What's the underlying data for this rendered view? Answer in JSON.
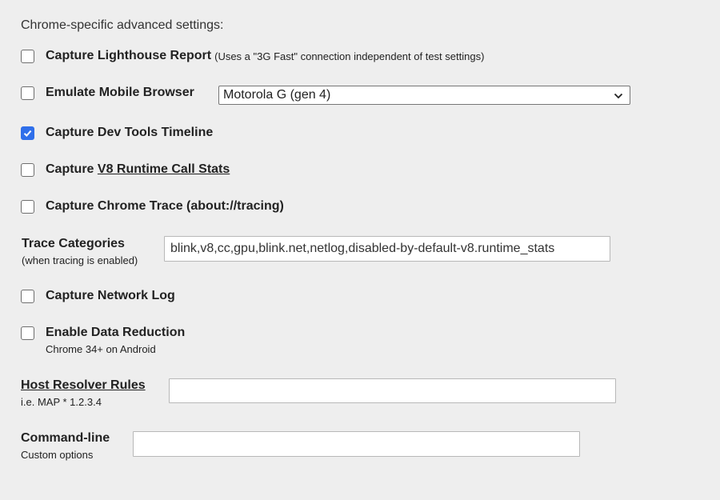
{
  "heading": "Chrome-specific advanced settings:",
  "lighthouse": {
    "label": "Capture Lighthouse Report",
    "note": "(Uses a \"3G Fast\" connection independent of test settings)",
    "checked": false
  },
  "emulate_mobile": {
    "label": "Emulate Mobile Browser",
    "checked": false,
    "device_selected": "Motorola G (gen 4)"
  },
  "devtools_timeline": {
    "label": "Capture Dev Tools Timeline",
    "checked": true
  },
  "v8_stats": {
    "prefix": "Capture",
    "link": "V8 Runtime Call Stats",
    "checked": false
  },
  "chrome_trace": {
    "label": "Capture Chrome Trace (about://tracing)",
    "checked": false
  },
  "trace_categories": {
    "label": "Trace Categories",
    "sublabel": "(when tracing is enabled)",
    "value": "blink,v8,cc,gpu,blink.net,netlog,disabled-by-default-v8.runtime_stats"
  },
  "network_log": {
    "label": "Capture Network Log",
    "checked": false
  },
  "data_reduction": {
    "label": "Enable Data Reduction",
    "sublabel": "Chrome 34+ on Android",
    "checked": false
  },
  "host_resolver": {
    "label": "Host Resolver Rules",
    "sublabel": "i.e. MAP * 1.2.3.4",
    "value": ""
  },
  "command_line": {
    "label": "Command-line",
    "sublabel": "Custom options",
    "value": ""
  },
  "colors": {
    "background": "#eeeeee",
    "checkbox_checked": "#2f6fea"
  }
}
